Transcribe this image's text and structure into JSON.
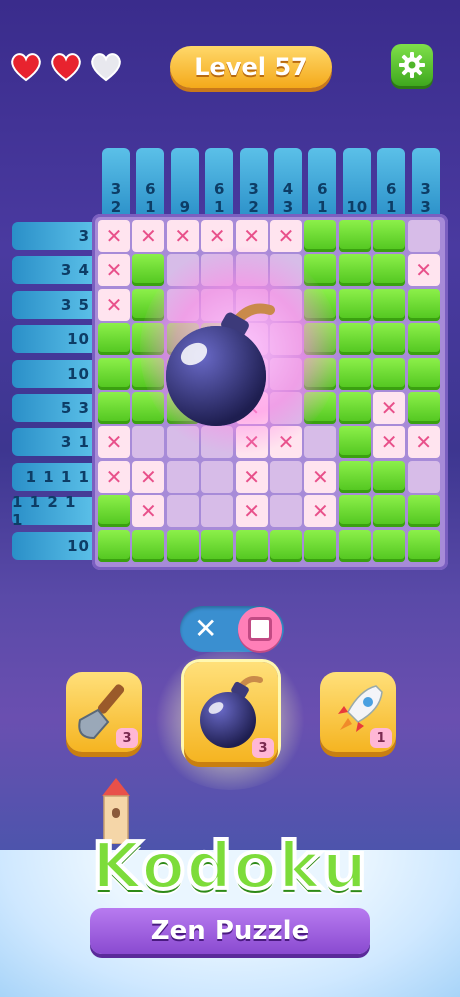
{
  "hud": {
    "level_label": "Level 57",
    "hearts": [
      "full",
      "full",
      "empty"
    ]
  },
  "colors": {
    "accent": "#f4a91a",
    "filled_cell": "#6ad82c",
    "cross": "#e8508a",
    "clue": "#3aa0d8"
  },
  "column_clues": [
    [
      "3",
      "2"
    ],
    [
      "6",
      "1"
    ],
    [
      "9"
    ],
    [
      "6",
      "1"
    ],
    [
      "3",
      "2"
    ],
    [
      "4",
      "3"
    ],
    [
      "6",
      "1"
    ],
    [
      "10"
    ],
    [
      "6",
      "1"
    ],
    [
      "3",
      "3"
    ]
  ],
  "row_clues": [
    "3",
    "3 4",
    "3 5",
    "10",
    "10",
    "5 3",
    "3 1",
    "1 1 1 1",
    "1 1 2 1 1",
    "10"
  ],
  "grid": [
    "xxxxxxggg x",
    "xg    gggx",
    "xg    gggg",
    "gggg  gggg",
    "gggg  gggg",
    "ggggx ggxg",
    "x   xx gxx",
    "xx  x xgg ",
    "gx  x xggg",
    "gggggggggg"
  ],
  "toggle": {
    "mode_cross": "✕",
    "mode_fill": "□"
  },
  "tools": [
    {
      "name": "shovel",
      "count": "3"
    },
    {
      "name": "bomb",
      "count": "3"
    },
    {
      "name": "rocket",
      "count": "1"
    }
  ],
  "logo": {
    "title": "Kodoku",
    "subtitle": "Zen Puzzle"
  },
  "icons": [
    "heart-icon",
    "gear-icon",
    "bomb-icon",
    "shovel-icon",
    "rocket-icon",
    "castle-icon"
  ]
}
